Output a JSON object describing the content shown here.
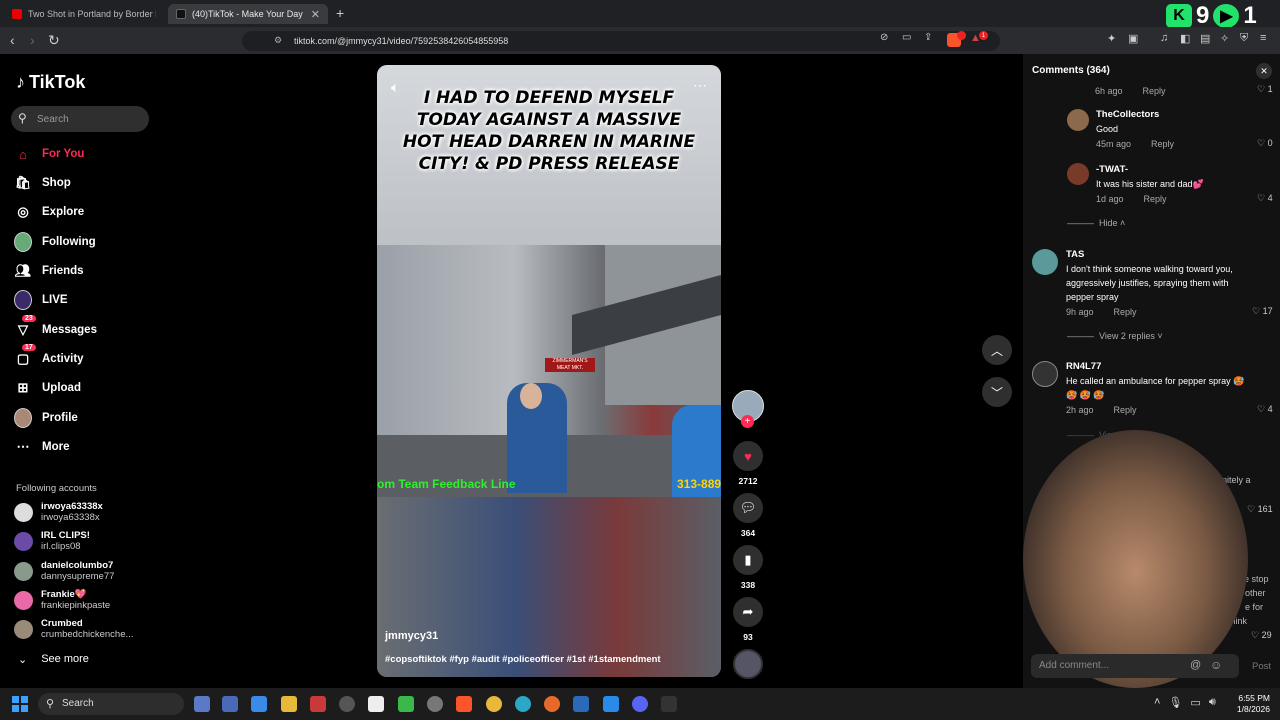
{
  "browser": {
    "tabs": [
      {
        "title": "Two Shot in Portland by Border Patro",
        "active": false
      },
      {
        "title": "(40)TikTok - Make Your Day",
        "active": true
      }
    ],
    "url": "tiktok.com/@jmmycy31/video/7592538426054855958",
    "kick_badge_count": "9",
    "extra_count": "1",
    "brave_badge": "1"
  },
  "sidebar": {
    "logo": "TikTok",
    "search_placeholder": "Search",
    "nav": [
      {
        "label": "For You",
        "icon": "home-icon",
        "active": true
      },
      {
        "label": "Shop",
        "icon": "shop-icon"
      },
      {
        "label": "Explore",
        "icon": "compass-icon"
      },
      {
        "label": "Following",
        "icon": "following-avatar"
      },
      {
        "label": "Friends",
        "icon": "friends-icon"
      },
      {
        "label": "LIVE",
        "icon": "live-icon"
      },
      {
        "label": "Messages",
        "icon": "messages-icon",
        "badge": "23"
      },
      {
        "label": "Activity",
        "icon": "activity-icon",
        "badge": "17"
      },
      {
        "label": "Upload",
        "icon": "upload-icon"
      },
      {
        "label": "Profile",
        "icon": "profile-avatar"
      },
      {
        "label": "More",
        "icon": "more-icon"
      }
    ],
    "following_title": "Following accounts",
    "accounts": [
      {
        "name": "irwoya63338x",
        "user": "irwoya63338x",
        "color": "#ddd"
      },
      {
        "name": "IRL CLIPS!",
        "user": "irl.clips08",
        "color": "#6c4aa8"
      },
      {
        "name": "danielcolumbo7",
        "user": "dannysupreme77",
        "color": "#8a9a8a"
      },
      {
        "name": "Frankie💖",
        "user": "frankiepinkpaste",
        "color": "#e86aa8"
      },
      {
        "name": "Crumbed",
        "user": "crumbedchickenche...",
        "color": "#9a8a7a"
      }
    ],
    "see_more": "See more"
  },
  "video": {
    "caption": "I HAD TO DEFEND MYSELF TODAY AGAINST A MASSIVE HOT HEAD DARREN IN MARINE CITY! & PD PRESS RELEASE",
    "sign_text": "ZIMMERMAN'S MEAT MKT.",
    "ticker": "om Team Feedback Line",
    "ticker_phone": "313-889",
    "author": "jmmycy31",
    "tags": "#copsoftiktok #fyp #audit #policeofficer #1st #1stamendment"
  },
  "actions": {
    "likes": "2712",
    "comments": "364",
    "saves": "338",
    "shares": "93"
  },
  "comments_panel": {
    "title": "Comments (364)",
    "top_meta_time": "6h ago",
    "top_meta_reply": "Reply",
    "top_meta_likes": "1",
    "items": [
      {
        "name": "TheCollectors",
        "text": "Good",
        "time": "45m ago",
        "reply": "Reply",
        "likes": "0"
      },
      {
        "name": "-TWAT-",
        "text": "It was his sister and dad💕",
        "time": "1d ago",
        "reply": "Reply",
        "likes": "4"
      },
      {
        "name": "TAS",
        "text": "I don't think someone walking toward you, aggressively justifies, spraying them with pepper spray",
        "time": "9h ago",
        "reply": "Reply",
        "likes": "17"
      },
      {
        "name": "RN4L77",
        "text": "He called an ambulance for pepper spray 🥵 🥵 🥵 🥵",
        "time": "2h ago",
        "reply": "Reply",
        "likes": "4"
      }
    ],
    "hide": "Hide",
    "view_replies": "View 2 replies",
    "view_partial": "View 1 reply",
    "partial_text": "initely a",
    "partial_likes": "161",
    "partial_text2a": "e stop",
    "partial_text2b": "other",
    "partial_text2c": "e for",
    "partial_text2d": "think",
    "partial_likes2": "29",
    "add_placeholder": "Add comment...",
    "post": "Post"
  },
  "taskbar": {
    "search": "Search",
    "time": "6:55 PM",
    "date": "1/8/2026"
  }
}
